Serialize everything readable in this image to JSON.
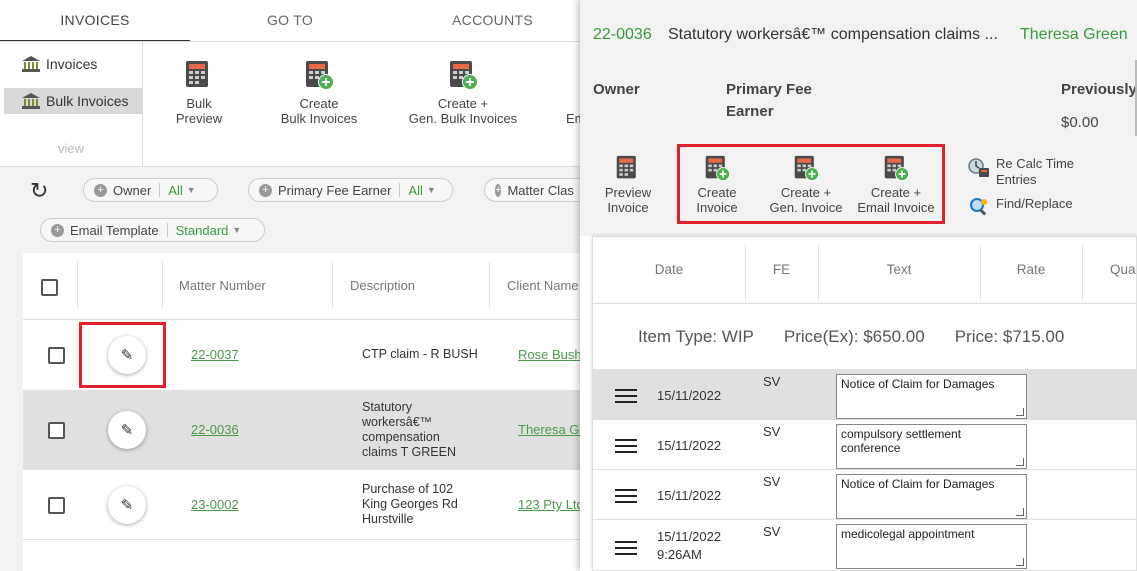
{
  "tabs": [
    "INVOICES",
    "GO TO",
    "ACCOUNTS"
  ],
  "sidebar": {
    "items": [
      {
        "label": "Invoices",
        "icon": "bank-icon"
      },
      {
        "label": "Bulk Invoices",
        "icon": "bank-icon"
      }
    ],
    "view_label": "view"
  },
  "ribbon": {
    "buttons": [
      {
        "line1": "Bulk",
        "line2": "Preview",
        "icon": "calculator-icon"
      },
      {
        "line1": "Create",
        "line2": "Bulk Invoices",
        "icon": "calculator-plus-icon"
      },
      {
        "line1": "Create +",
        "line2": "Gen. Bulk Invoices",
        "icon": "calculator-plus-icon"
      },
      {
        "line1": "",
        "line2": "Em",
        "icon": ""
      }
    ]
  },
  "filters": {
    "owner": {
      "label": "Owner",
      "value": "All"
    },
    "fee_earner": {
      "label": "Primary Fee Earner",
      "value": "All"
    },
    "matter_class": {
      "label": "Matter Clas"
    },
    "email_template": {
      "label": "Email Template",
      "value": "Standard"
    }
  },
  "table": {
    "headers": {
      "matter": "Matter Number",
      "description": "Description",
      "client": "Client Name"
    },
    "rows": [
      {
        "matter": "22-0037",
        "description": "CTP claim - R BUSH",
        "client": "Rose Bush"
      },
      {
        "matter": "22-0036",
        "description": "Statutory workersâ€™ compensation claims T GREEN",
        "client": "Theresa Gre"
      },
      {
        "matter": "23-0002",
        "description": "Purchase of 102 King Georges Rd Hurstville",
        "client": "123 Pty Ltd"
      }
    ]
  },
  "panel": {
    "matter_number": "22-0036",
    "title": "Statutory workersâ€™ compensation claims ...",
    "client": "Theresa Green",
    "owner_label": "Owner",
    "fee_earner_label_1": "Primary Fee",
    "fee_earner_label_2": "Earner",
    "previously_label": "Previously",
    "previously_value": "$0.00",
    "buttons": [
      {
        "line1": "Preview",
        "line2": "Invoice"
      },
      {
        "line1": "Create",
        "line2": "Invoice"
      },
      {
        "line1": "Create +",
        "line2": "Gen. Invoice"
      },
      {
        "line1": "Create +",
        "line2": "Email Invoice"
      }
    ],
    "tools": {
      "recalc_1": "Re Calc Time",
      "recalc_2": "Entries",
      "find_replace": "Find/Replace"
    },
    "grid_headers": {
      "date": "Date",
      "fe": "FE",
      "text": "Text",
      "rate": "Rate",
      "qty": "Qua"
    },
    "summary": {
      "item_type": "Item Type: WIP",
      "price_ex": "Price(Ex): $650.00",
      "price": "Price: $715.00"
    },
    "entries": [
      {
        "date": "15/11/2022",
        "time": "",
        "fe": "SV",
        "text": "Notice of Claim for Damages"
      },
      {
        "date": "15/11/2022",
        "time": "",
        "fe": "SV",
        "text": "compulsory settlement conference"
      },
      {
        "date": "15/11/2022",
        "time": "",
        "fe": "SV",
        "text": "Notice of Claim for Damages"
      },
      {
        "date": "15/11/2022",
        "time": "9:26AM",
        "fe": "SV",
        "text": "medicolegal appointment"
      }
    ]
  },
  "colors": {
    "accent_green": "#3a9a3a",
    "highlight_red": "#e0202a",
    "selected_row": "#e0e0e0"
  }
}
